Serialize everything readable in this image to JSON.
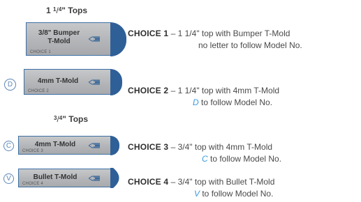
{
  "headings": {
    "top1": {
      "whole": "1 ",
      "num": "1",
      "den": "4",
      "suffix": "\" Tops"
    },
    "top2": {
      "num": "3",
      "den": "4",
      "suffix": "\" Tops"
    }
  },
  "colors": {
    "accent": "#2f5f97",
    "letter": "#5d86b6",
    "highlight": "#3a9be0"
  },
  "profiles": [
    {
      "line1": "3/8\" Bumper",
      "line2": "T-Mold",
      "code": "CHOICE 1",
      "letter": "",
      "shape": "round"
    },
    {
      "line1": "4mm T-Mold",
      "line2": "",
      "code": "CHOICE 2",
      "letter": "D",
      "shape": "round"
    },
    {
      "line1": "4mm T-Mold",
      "line2": "",
      "code": "CHOICE 3",
      "letter": "C",
      "shape": "round"
    },
    {
      "line1": "Bullet T-Mold",
      "line2": "",
      "code": "CHOICE 4",
      "letter": "V",
      "shape": "bullet"
    }
  ],
  "choices": [
    {
      "title": "CHOICE 1",
      "desc": " – 1 1/4\" top with Bumper T-Mold",
      "letter": "",
      "follow": "no letter to follow Model No."
    },
    {
      "title": "CHOICE 2",
      "desc": " – 1 1/4\" top with 4mm T-Mold",
      "letter": "D",
      "follow": " to follow Model No."
    },
    {
      "title": "CHOICE 3",
      "desc": " –  3/4\" top with 4mm T-Mold",
      "letter": "C",
      "follow": " to follow Model No."
    },
    {
      "title": "CHOICE 4",
      "desc": " – 3/4\" top with Bullet T-Mold",
      "letter": "V",
      "follow": " to follow Model No."
    }
  ]
}
